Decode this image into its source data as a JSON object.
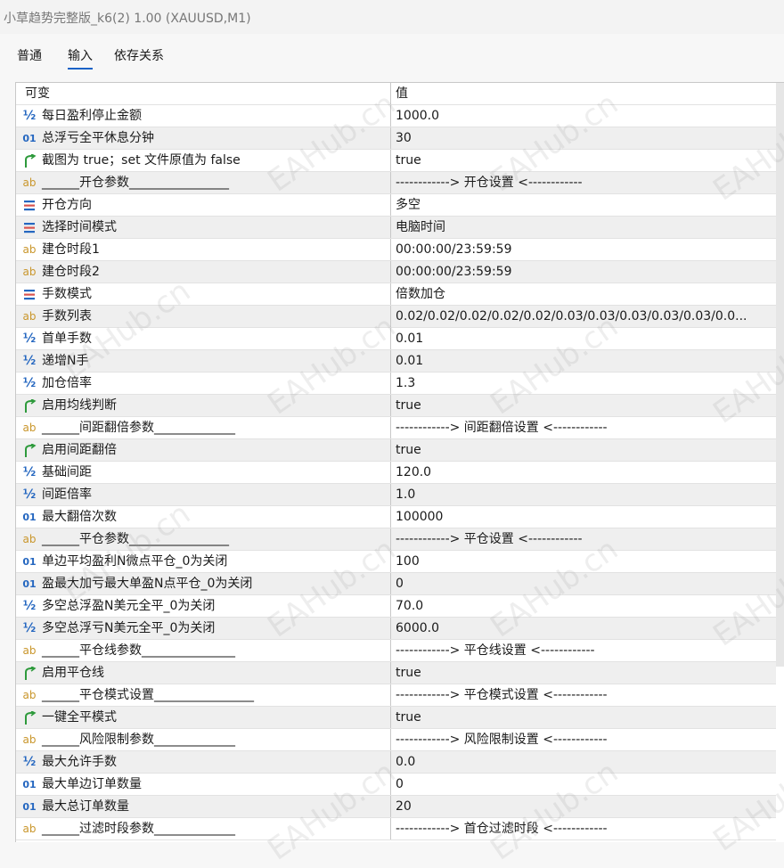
{
  "window": {
    "title": "小草趋势完整版_k6(2) 1.00 (XAUUSD,M1)"
  },
  "tabs": [
    {
      "label": "普通",
      "active": false
    },
    {
      "label": "输入",
      "active": true
    },
    {
      "label": "依存关系",
      "active": false
    }
  ],
  "table": {
    "headers": {
      "variable": "可变",
      "value": "值"
    },
    "rows": [
      {
        "icon": "double-icon",
        "name": "每日盈利停止金额",
        "value": "1000.0"
      },
      {
        "icon": "integer-icon",
        "name": "总浮亏全平休息分钟",
        "value": "30"
      },
      {
        "icon": "bool-icon",
        "name": "截图为 true；set 文件原值为 false",
        "value": "true"
      },
      {
        "icon": "string-icon",
        "name": "______开仓参数________________",
        "value": "------------> 开仓设置 <------------"
      },
      {
        "icon": "enum-icon",
        "name": "开仓方向",
        "value": "多空"
      },
      {
        "icon": "enum-icon",
        "name": "选择时间模式",
        "value": "电脑时间"
      },
      {
        "icon": "string-icon",
        "name": "建仓时段1",
        "value": "00:00:00/23:59:59"
      },
      {
        "icon": "string-icon",
        "name": "建仓时段2",
        "value": "00:00:00/23:59:59"
      },
      {
        "icon": "enum-icon",
        "name": "手数模式",
        "value": "倍数加仓"
      },
      {
        "icon": "string-icon",
        "name": "手数列表",
        "value": "0.02/0.02/0.02/0.02/0.02/0.03/0.03/0.03/0.03/0.03/0.0..."
      },
      {
        "icon": "double-icon",
        "name": "首单手数",
        "value": "0.01"
      },
      {
        "icon": "double-icon",
        "name": "递增N手",
        "value": "0.01"
      },
      {
        "icon": "double-icon",
        "name": "加仓倍率",
        "value": "1.3"
      },
      {
        "icon": "bool-icon",
        "name": "启用均线判断",
        "value": "true"
      },
      {
        "icon": "string-icon",
        "name": "______间距翻倍参数_____________",
        "value": "------------> 间距翻倍设置 <------------"
      },
      {
        "icon": "bool-icon",
        "name": "启用间距翻倍",
        "value": "true"
      },
      {
        "icon": "double-icon",
        "name": "基础间距",
        "value": "120.0"
      },
      {
        "icon": "double-icon",
        "name": "间距倍率",
        "value": "1.0"
      },
      {
        "icon": "integer-icon",
        "name": "最大翻倍次数",
        "value": "100000"
      },
      {
        "icon": "string-icon",
        "name": "______平仓参数________________",
        "value": "------------> 平仓设置 <------------"
      },
      {
        "icon": "integer-icon",
        "name": "单边平均盈利N微点平仓_0为关闭",
        "value": "100"
      },
      {
        "icon": "integer-icon",
        "name": "盈最大加亏最大单盈N点平仓_0为关闭",
        "value": "0"
      },
      {
        "icon": "double-icon",
        "name": "多空总浮盈N美元全平_0为关闭",
        "value": "70.0"
      },
      {
        "icon": "double-icon",
        "name": "多空总浮亏N美元全平_0为关闭",
        "value": "6000.0"
      },
      {
        "icon": "string-icon",
        "name": "______平仓线参数_______________",
        "value": "------------> 平仓线设置 <------------"
      },
      {
        "icon": "bool-icon",
        "name": "启用平仓线",
        "value": "true"
      },
      {
        "icon": "string-icon",
        "name": "______平仓模式设置________________",
        "value": "------------> 平仓模式设置 <------------"
      },
      {
        "icon": "bool-icon",
        "name": "一键全平模式",
        "value": "true"
      },
      {
        "icon": "string-icon",
        "name": "______风险限制参数_____________",
        "value": "------------> 风险限制设置 <------------"
      },
      {
        "icon": "double-icon",
        "name": "最大允许手数",
        "value": "0.0"
      },
      {
        "icon": "integer-icon",
        "name": "最大单边订单数量",
        "value": "0"
      },
      {
        "icon": "integer-icon",
        "name": "最大总订单数量",
        "value": "20"
      },
      {
        "icon": "string-icon",
        "name": "______过滤时段参数_____________",
        "value": "------------> 首仓过滤时段 <------------"
      }
    ]
  },
  "icon_glyphs": {
    "double-icon": "½",
    "integer-icon": "01",
    "string-icon": "ab"
  },
  "watermark": {
    "text": "EAHub.cn"
  },
  "colors": {
    "accent": "#1a62c7",
    "icon_blue": "#2567c0",
    "icon_green": "#2e9a3c",
    "icon_orange": "#c9962b",
    "icon_red": "#d9534f"
  }
}
